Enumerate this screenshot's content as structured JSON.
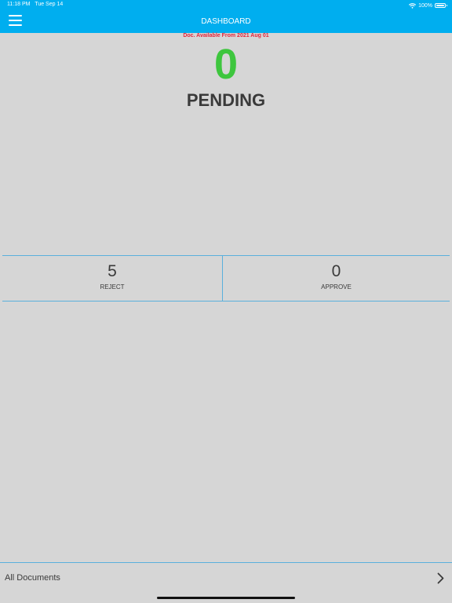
{
  "status_bar": {
    "time": "11:18 PM",
    "date": "Tue Sep 14",
    "battery": "100%",
    "wifi_icon": "wifi-icon",
    "battery_icon": "battery-icon"
  },
  "header": {
    "title": "DASHBOARD",
    "menu_icon": "hamburger-menu-icon",
    "background_color": "#00aeef"
  },
  "main": {
    "availability_note": "Doc. Available From 2021 Aug 01",
    "pending_count": "0",
    "pending_label": "PENDING",
    "colors": {
      "note": "#e4243a",
      "pending_count": "#3ec63e",
      "divider": "#5ab0dc",
      "background": "#d6d6d6"
    }
  },
  "stats": [
    {
      "value": "5",
      "label": "REJECT"
    },
    {
      "value": "0",
      "label": "APPROVE"
    }
  ],
  "footer": {
    "all_documents_label": "All Documents",
    "chevron_icon": "chevron-right-icon"
  }
}
